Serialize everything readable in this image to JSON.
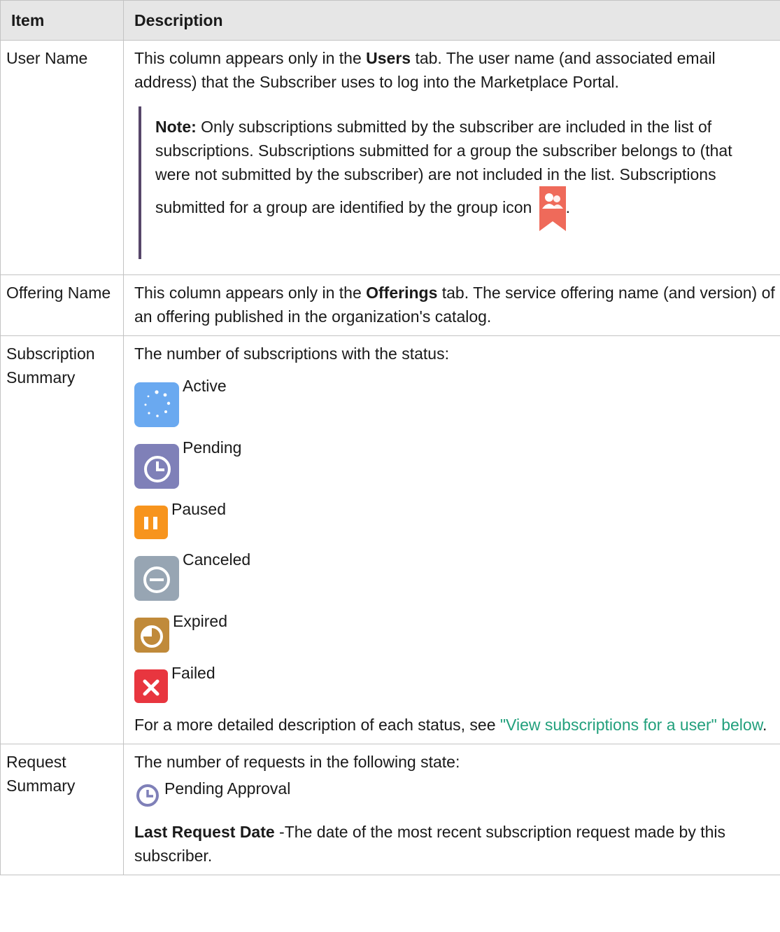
{
  "table": {
    "headers": {
      "item": "Item",
      "description": "Description"
    },
    "user_name": {
      "item": "User Name",
      "desc_pre": "This column appears only in the ",
      "desc_bold": "Users",
      "desc_post": " tab. The user name (and associated email address) that the Subscriber uses to log into the Marketplace Portal.",
      "note_label": "Note:",
      "note_text": " Only subscriptions submitted by the subscriber are included in the list of subscriptions. Subscriptions submitted for a group the subscriber belongs to (that were not submitted by the subscriber) are not included in the list. Subscriptions submitted for a group are identified by the group icon ",
      "note_end": ".",
      "group_icon": "group-icon"
    },
    "offering_name": {
      "item": "Offering Name",
      "desc_pre": "This column appears only in the ",
      "desc_bold": "Offerings",
      "desc_post": " tab. The service offering name (and version) of an offering published in the organization's catalog."
    },
    "subscription_summary": {
      "item": "Subscription Summary",
      "intro": "The number of subscriptions with the status:",
      "statuses": [
        {
          "label": "Active",
          "icon": "active-icon",
          "color": "#6aa9f0"
        },
        {
          "label": "Pending",
          "icon": "pending-clock-icon",
          "color": "#7f80b8"
        },
        {
          "label": "Paused",
          "icon": "paused-icon",
          "color": "#f7941d"
        },
        {
          "label": "Canceled",
          "icon": "canceled-icon",
          "color": "#97a5b3"
        },
        {
          "label": "Expired",
          "icon": "expired-icon",
          "color": "#c08a3a"
        },
        {
          "label": "Failed",
          "icon": "failed-icon",
          "color": "#e8363f"
        }
      ],
      "more_pre": "For a more detailed description of each status, see ",
      "more_link": "\"View subscriptions for a user\" below",
      "more_post": "."
    },
    "request_summary": {
      "item": "Request Summary",
      "intro": "The number of requests in the following state:",
      "state_label": "Pending Approval",
      "state_icon": "pending-approval-clock-icon",
      "last_bold": "Last Request Date",
      "last_text": " -The date of the most recent subscription request made by this subscriber."
    }
  },
  "colors": {
    "link": "#22a07c",
    "note_bar": "#57466a",
    "header_bg": "#e6e6e6",
    "border": "#c3c3c3"
  }
}
